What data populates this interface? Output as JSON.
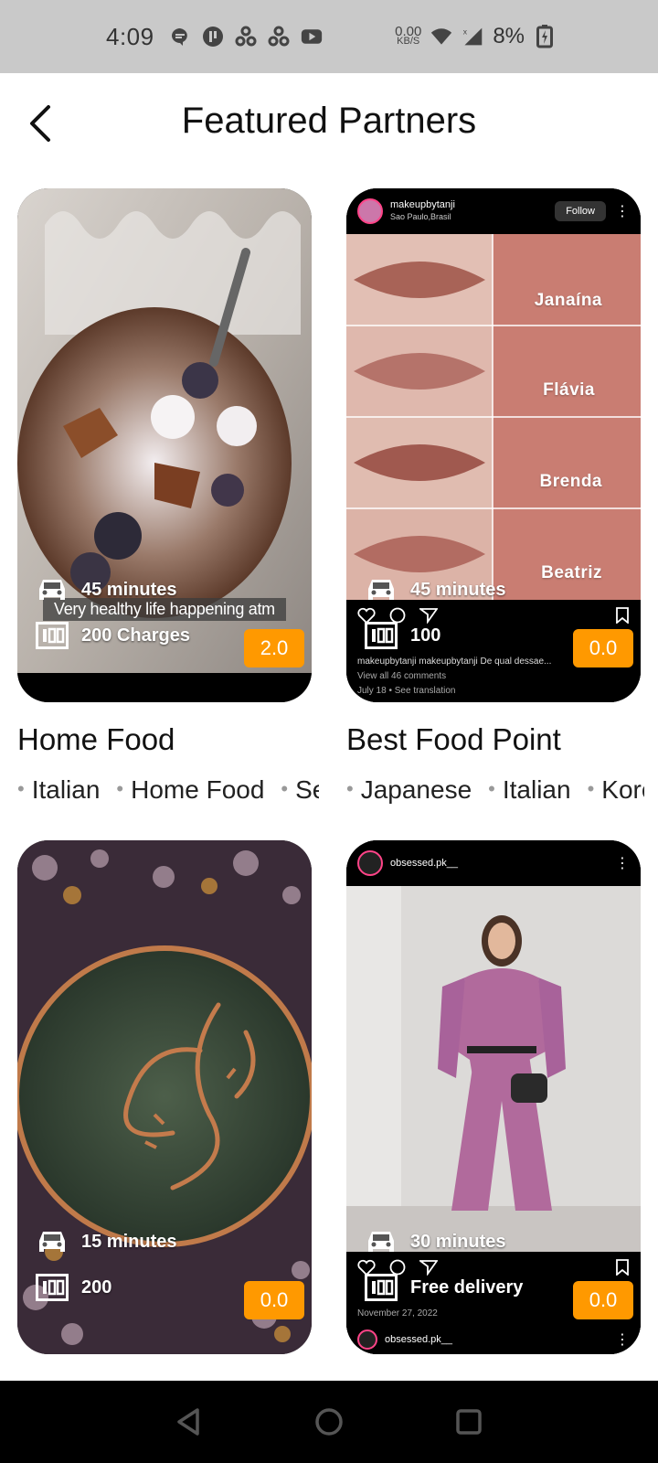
{
  "status_bar": {
    "time": "4:09",
    "net_speed_value": "0.00",
    "net_speed_unit": "KB/S",
    "battery": "8%",
    "icons": [
      "chat-bubble-icon",
      "pocket-icon",
      "recycle-icon",
      "recycle-icon",
      "youtube-icon",
      "wifi-icon",
      "signal-icon",
      "battery-charging-icon"
    ]
  },
  "header": {
    "title": "Featured Partners",
    "back_icon": "chevron-left-icon"
  },
  "partners": [
    {
      "name": "Home Food",
      "delivery_time": "45 minutes",
      "charges": "200 Charges",
      "rating": "2.0",
      "cuisines": [
        "Italian",
        "Home Food",
        "Seafood"
      ],
      "image_caption": "Very healthy life happening atm"
    },
    {
      "name": "Best Food Point",
      "delivery_time": "45 minutes",
      "charges": "100",
      "rating": "0.0",
      "cuisines": [
        "Japanese",
        "Italian",
        "Korean"
      ],
      "ig_user": "makeupbytanji",
      "ig_location": "Sao Paulo,Brasil",
      "ig_follow": "Follow",
      "shades": [
        "Janaína",
        "Flávia",
        "Brenda",
        "Beatriz"
      ],
      "ig_caption": "makeupbytanji makeupbytanji De qual dessae...",
      "ig_comments": "View all 46 comments",
      "ig_date": "July 18 • See translation"
    },
    {
      "name": "",
      "delivery_time": "15 minutes",
      "charges": "200",
      "rating": "0.0"
    },
    {
      "name": "",
      "delivery_time": "30 minutes",
      "charges": "Free delivery",
      "rating": "0.0",
      "ig_user": "obsessed.pk__",
      "ig_date": "November 27, 2022"
    }
  ],
  "colors": {
    "accent": "#ff9900",
    "status_bar": "#c9c9c9",
    "nav_bar": "#000000"
  },
  "nav": [
    "back-triangle-icon",
    "home-circle-icon",
    "recents-square-icon"
  ]
}
